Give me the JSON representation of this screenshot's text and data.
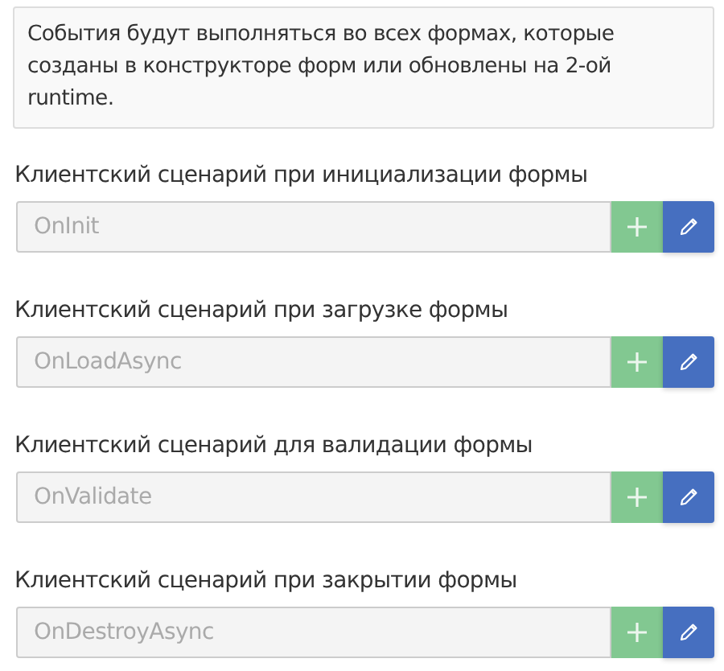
{
  "notice": "События будут выполняться во всех формах, которые созданы в конструкторе форм или обновлены на 2-ой runtime.",
  "scripts": [
    {
      "label": "Клиентский сценарий при инициализации формы",
      "value": "OnInit",
      "disabled": true
    },
    {
      "label": "Клиентский сценарий при загрузке формы",
      "value": "OnLoadAsync",
      "disabled": true
    },
    {
      "label": "Клиентский сценарий для валидации формы",
      "value": "OnValidate",
      "disabled": true
    },
    {
      "label": "Клиентский сценарий при закрытии формы",
      "value": "OnDestroyAsync",
      "disabled": true
    }
  ]
}
